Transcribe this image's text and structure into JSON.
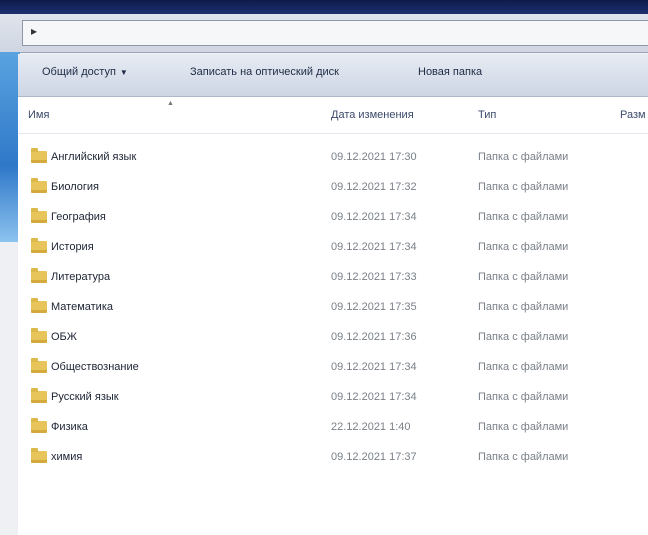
{
  "toolbar": {
    "share_label": "Общий доступ",
    "burn_label": "Записать на оптический диск",
    "new_folder_label": "Новая папка"
  },
  "columns": {
    "name": "Имя",
    "date": "Дата изменения",
    "type": "Тип",
    "size": "Разм"
  },
  "files": [
    {
      "name": "Английский язык",
      "date": "09.12.2021 17:30",
      "type": "Папка с файлами"
    },
    {
      "name": "Биология",
      "date": "09.12.2021 17:32",
      "type": "Папка с файлами"
    },
    {
      "name": "География",
      "date": "09.12.2021 17:34",
      "type": "Папка с файлами"
    },
    {
      "name": "История",
      "date": "09.12.2021 17:34",
      "type": "Папка с файлами"
    },
    {
      "name": "Литература",
      "date": "09.12.2021 17:33",
      "type": "Папка с файлами"
    },
    {
      "name": "Математика",
      "date": "09.12.2021 17:35",
      "type": "Папка с файлами"
    },
    {
      "name": "ОБЖ",
      "date": "09.12.2021 17:36",
      "type": "Папка с файлами"
    },
    {
      "name": "Обществознание",
      "date": "09.12.2021 17:34",
      "type": "Папка с файлами"
    },
    {
      "name": "Русский язык",
      "date": "09.12.2021 17:34",
      "type": "Папка с файлами"
    },
    {
      "name": "Физика",
      "date": "22.12.2021 1:40",
      "type": "Папка с файлами"
    },
    {
      "name": "химия",
      "date": "09.12.2021 17:37",
      "type": "Папка с файлами"
    }
  ]
}
